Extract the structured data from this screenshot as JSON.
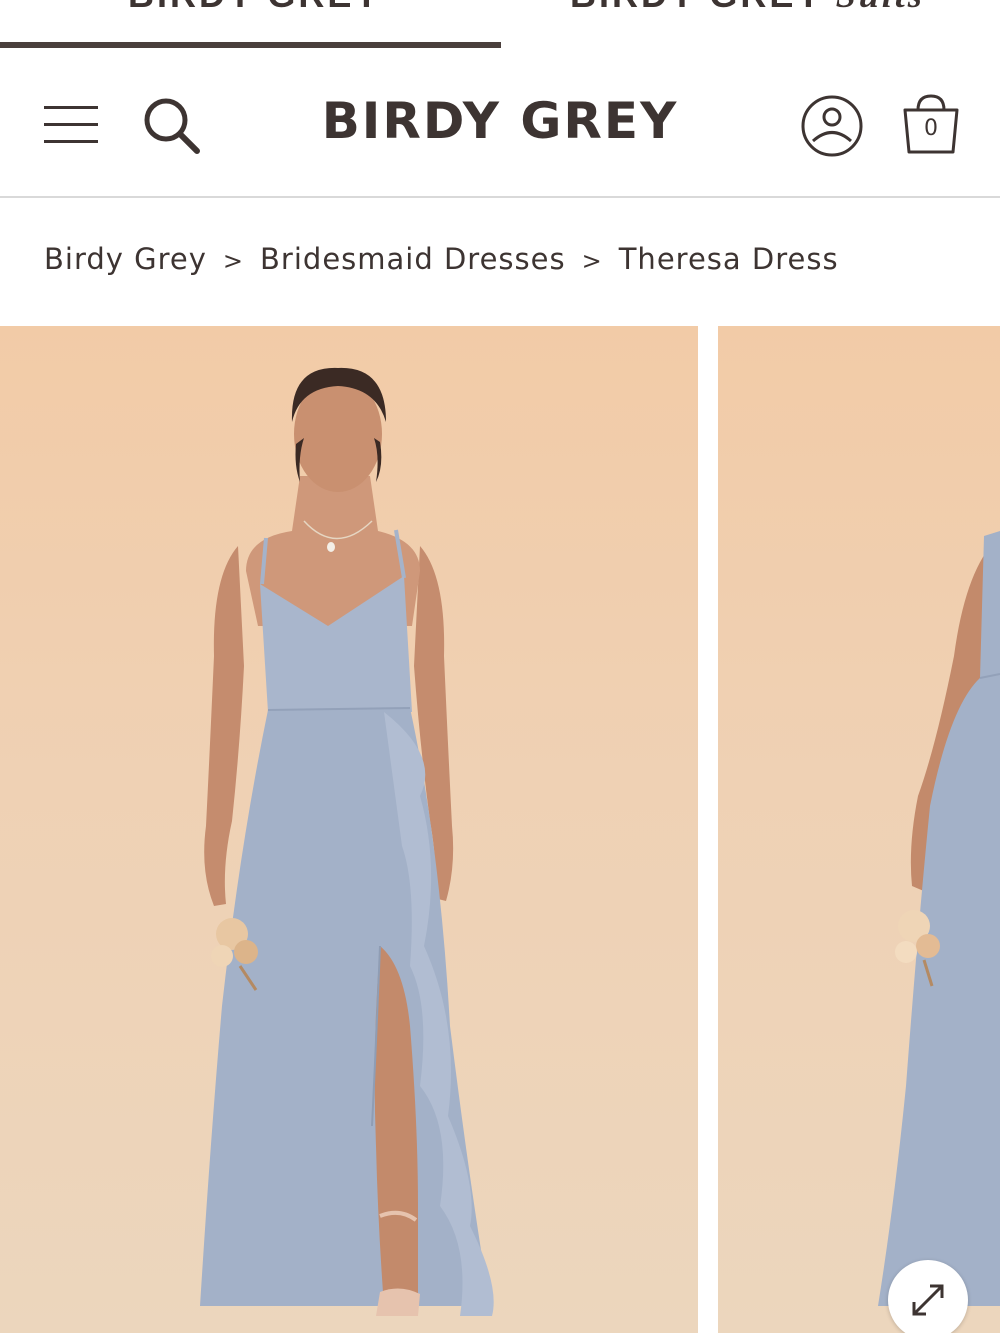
{
  "brand_tabs": {
    "left_label": "BIRDY GREY",
    "right_label_main": "BIRDY GREY",
    "right_label_italic": "Suits"
  },
  "header": {
    "logo": "BIRDY GREY",
    "cart_count": "0",
    "icons": [
      "menu-icon",
      "search-icon",
      "account-icon",
      "shopping-bag-icon"
    ]
  },
  "breadcrumb": {
    "items": [
      "Birdy Grey",
      "Bridesmaid Dresses",
      "Theresa Dress"
    ],
    "separator": ">"
  },
  "gallery": {
    "expand_icon": "expand-icon",
    "colors": {
      "background": "#efcfae",
      "dress": "#a5b3ca"
    }
  }
}
